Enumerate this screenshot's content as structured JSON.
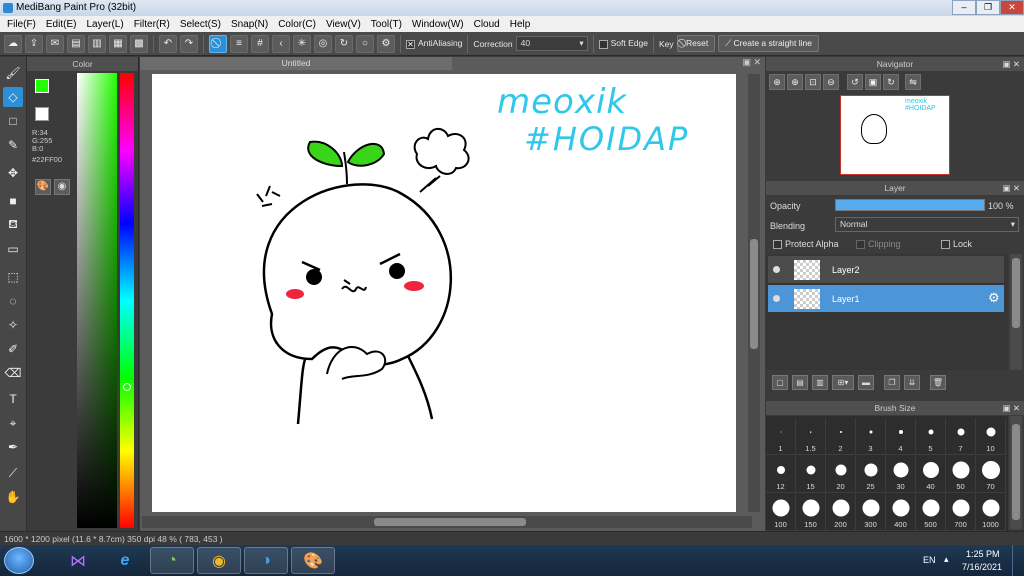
{
  "window": {
    "title": "MediBang Paint Pro (32bit)",
    "minimize": "–",
    "maximize": "❐",
    "close": "✕"
  },
  "menu": [
    "File(F)",
    "Edit(E)",
    "Layer(L)",
    "Filter(R)",
    "Select(S)",
    "Snap(N)",
    "Color(C)",
    "View(V)",
    "Tool(T)",
    "Window(W)",
    "Cloud",
    "Help"
  ],
  "toolbar": {
    "antialiasing_label": "AntiAliasing",
    "antialiasing_checked": true,
    "correction_label": "Correction",
    "correction_value": "40",
    "soft_edge_label": "Soft Edge",
    "key_label": "Key",
    "reset_label": "Reset",
    "straight_line_label": "Create a straight line"
  },
  "color_panel": {
    "title": "Color",
    "r": "R:34",
    "g": "G:255",
    "b": "B:0",
    "hex": "#22FF00",
    "primary_color": "#22FF00",
    "secondary_color": "#FF1E6E"
  },
  "document": {
    "tab_title": "Untitled",
    "handwriting_line1": "meoxik",
    "handwriting_line2": "#HOIDAP"
  },
  "navigator": {
    "title": "Navigator",
    "thumb_text1": "meoxik",
    "thumb_text2": "#HOIDAP"
  },
  "layer_panel": {
    "title": "Layer",
    "opacity_label": "Opacity",
    "opacity_value": "100 %",
    "opacity_fraction": 1.0,
    "blending_label": "Blending",
    "blending_value": "Normal",
    "protect_alpha_label": "Protect Alpha",
    "clipping_label": "Clipping",
    "lock_label": "Lock",
    "layers": [
      {
        "name": "Layer2",
        "selected": false
      },
      {
        "name": "Layer1",
        "selected": true
      }
    ]
  },
  "brush_panel": {
    "title": "Brush Size",
    "sizes": [
      "1",
      "1.5",
      "2",
      "3",
      "4",
      "5",
      "7",
      "10",
      "12",
      "15",
      "20",
      "25",
      "30",
      "40",
      "50",
      "70",
      "100",
      "150",
      "200",
      "300",
      "400",
      "500",
      "700",
      "1000"
    ]
  },
  "status": {
    "text": "1600 * 1200 pixel   (11.6 * 8.7cm)   350 dpi   48 %   ( 783, 453 )"
  },
  "taskbar": {
    "language": "EN",
    "time": "1:25 PM",
    "date": "7/16/2021"
  },
  "colors": {
    "accent": "#2f8fd6",
    "layer_selected": "#4c96d7",
    "panel_bg": "#3b3b3b"
  }
}
